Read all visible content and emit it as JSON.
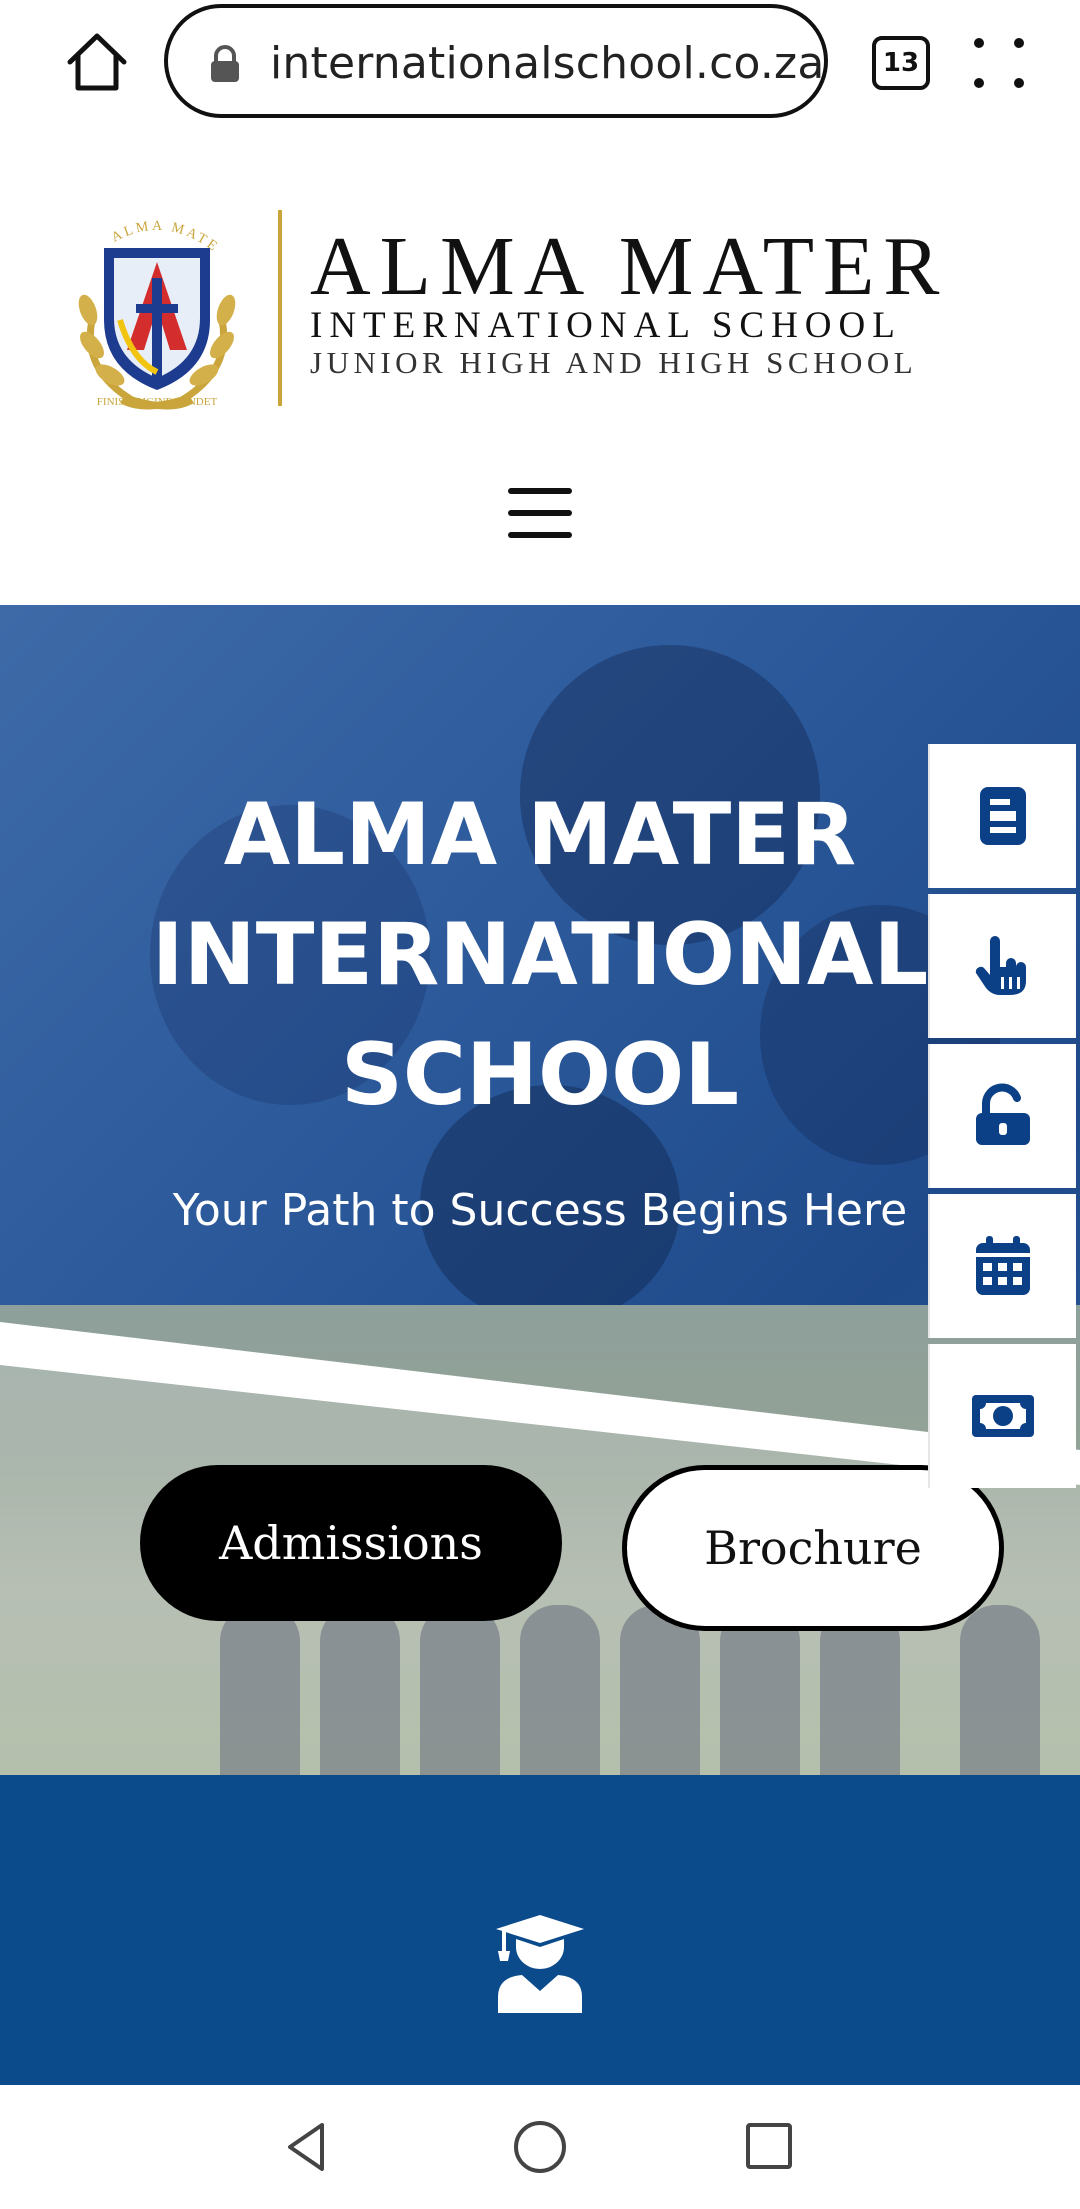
{
  "browser": {
    "url": "internationalschool.co.za",
    "tab_count": "13",
    "icons": [
      "home-icon",
      "lock-icon",
      "tabs-icon",
      "more-menu-icon"
    ]
  },
  "header": {
    "logo_line1": "ALMA MATER",
    "logo_line2": "INTERNATIONAL SCHOOL",
    "logo_line3": "JUNIOR HIGH AND HIGH SCHOOL",
    "crest_motto_top": "ALMA MATER",
    "crest_motto_bottom": "FINIS ORIGINE PENDET",
    "menu_icon": "hamburger-menu-icon"
  },
  "hero": {
    "title_line1": "ALMA MATER",
    "title_line2": "INTERNATIONAL",
    "title_line3": "SCHOOL",
    "subtitle": "Your Path to Success Begins Here",
    "admissions_label": "Admissions",
    "brochure_label": "Brochure"
  },
  "side_links": [
    {
      "icon": "document-icon"
    },
    {
      "icon": "pointer-hand-icon"
    },
    {
      "icon": "unlock-icon"
    },
    {
      "icon": "calendar-icon"
    },
    {
      "icon": "money-icon"
    }
  ],
  "section": {
    "icon": "graduate-icon"
  },
  "colors": {
    "brand_blue": "#0b4a8b",
    "icon_blue": "#0b3f86",
    "gold": "#c9a53b"
  }
}
